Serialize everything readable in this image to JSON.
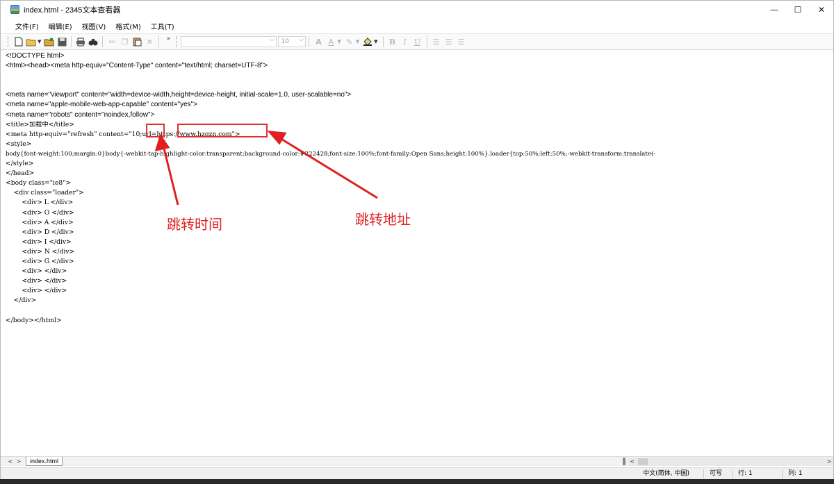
{
  "window": {
    "title": "index.html - 2345文本查看器",
    "controls": {
      "minimize": "—",
      "maximize": "☐",
      "close": "✕"
    }
  },
  "menu": [
    "文件(F)",
    "编辑(E)",
    "视图(V)",
    "格式(M)",
    "工具(T)"
  ],
  "toolbar": {
    "font_size": "10",
    "bold": "B",
    "italic": "I",
    "underline": "U"
  },
  "editor": {
    "lines": [
      "<!DOCTYPE html>",
      "<html><head><meta http-equiv=\"Content-Type\" content=\"text/html; charset=UTF-8\">",
      "",
      "",
      "<meta name=\"viewport\" content=\"width=device-width,height=device-height, initial-scale=1.0, user-scalable=no\">",
      "<meta name=\"apple-mobile-web-app-capable\" content=\"yes\">",
      "<meta name=\"robots\" content=\"noindex,follow\">",
      "<title>加载中</title>",
      "<meta http-equiv=\"refresh\" content=\"10;url=https://www.hzgzn.com\">",
      "<style>",
      "body{font-weight:100;margin:0}body{-webkit-tap-highlight-color:transparent;background-color:#222428;font-size:100%;font-family:Open Sans;height:100%}.loader{top:50%;left:50%;-webkit-transform:translate(-",
      "</style>",
      "</head>",
      "<body class=\"ie8\">",
      "    <div class=\"loader\">",
      "        <div> L </div>",
      "        <div> O </div>",
      "        <div> A </div>",
      "        <div> D </div>",
      "        <div> I </div>",
      "        <div> N </div>",
      "        <div> G </div>",
      "        <div> </div>",
      "        <div> </div>",
      "        <div> </div>",
      "    </div>",
      "",
      "</body></html>"
    ]
  },
  "annotations": {
    "refresh_time_label": "跳转时间",
    "redirect_url_label": "跳转地址",
    "color": "#e02020"
  },
  "tabs": {
    "active": "index.html"
  },
  "status": {
    "language": "中文(简体, 中国)",
    "mode": "可写",
    "row": "行: 1",
    "col": "列: 1"
  }
}
